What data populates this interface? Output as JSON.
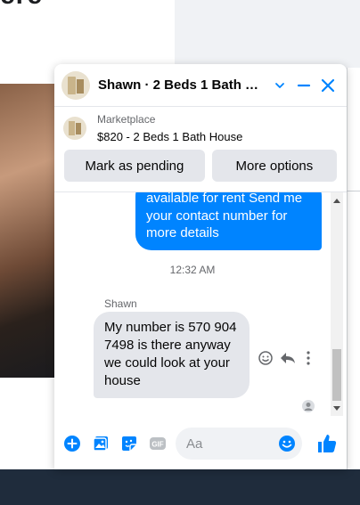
{
  "background": {
    "heading_fragment": "ere"
  },
  "chat": {
    "title": "Shawn · 2 Beds 1 Bath Hou…",
    "marketplace": {
      "source": "Marketplace",
      "listing": "$820 - 2 Beds 1 Bath House"
    },
    "actions": {
      "mark_pending": "Mark as pending",
      "more_options": "More options"
    },
    "messages": {
      "sent_partial": "available for rent Send me your contact number for more details",
      "timestamp": "12:32 AM",
      "sender_name": "Shawn",
      "received": "My number is 570 904 7498 is there anyway we could look at your house"
    },
    "composer": {
      "placeholder": "Aa"
    },
    "colors": {
      "accent": "#0084ff",
      "bubble_received": "#e4e6eb"
    },
    "icons": [
      "chevron-down-icon",
      "minimize-icon",
      "close-icon",
      "emoji-react-icon",
      "reply-icon",
      "more-icon",
      "plus-circle-icon",
      "photo-icon",
      "sticker-icon",
      "gif-icon",
      "emoji-icon",
      "thumbs-up-icon"
    ]
  }
}
